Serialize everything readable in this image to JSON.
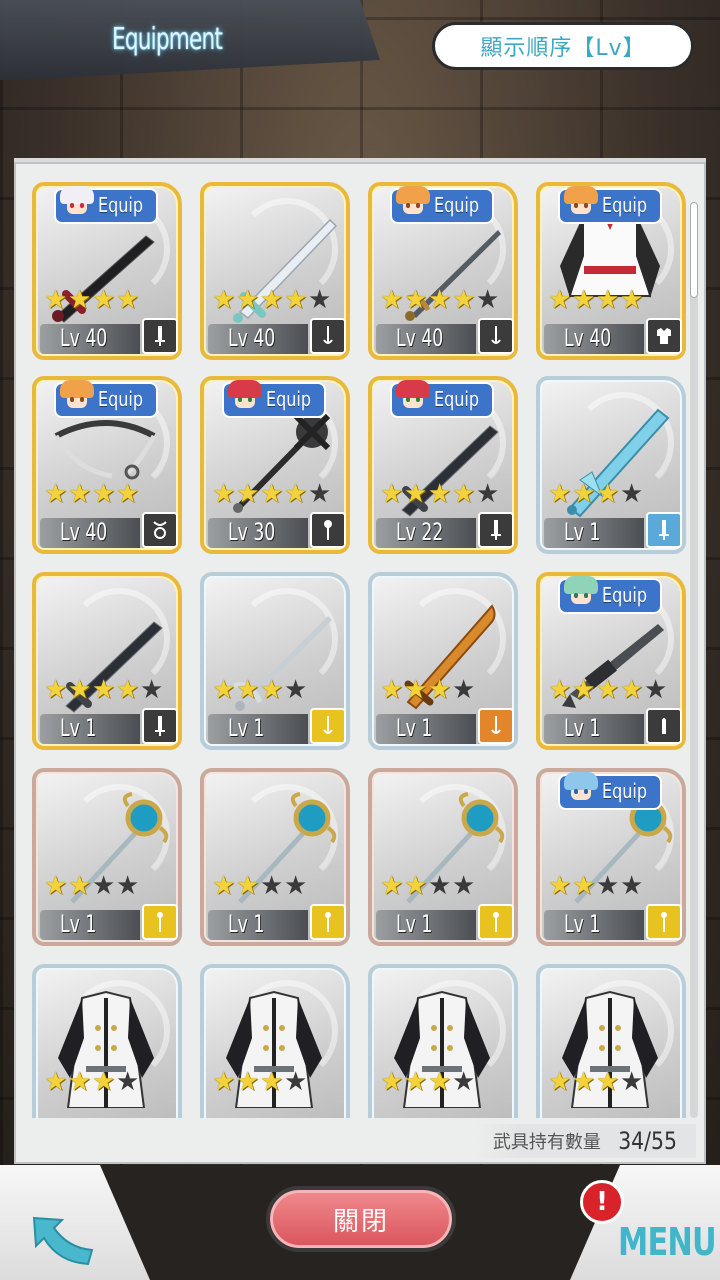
{
  "header": {
    "title": "Equipment",
    "sort_label": "顯示順序【Lv】"
  },
  "footer": {
    "count_label": "武具持有數量",
    "count_value": "34/55",
    "close_label": "關閉",
    "menu_label": "MENU",
    "alert_label": "!"
  },
  "colors": {
    "accent": "#3ca7c4",
    "close": "#d9545b",
    "gold_frame": "#e9b93b",
    "silver_frame": "#b8cdd8",
    "bronze_frame": "#c9a99c",
    "star_on": "#f4d33a"
  },
  "items": [
    {
      "frame": "gold",
      "stars": 4,
      "max_stars": 4,
      "level": "Lv 40",
      "equip": "Equip",
      "equipper": "white-hair",
      "art": "sword-black",
      "type_icon": "sword-icon",
      "type_color": "#3b3b3b"
    },
    {
      "frame": "gold",
      "stars": 4,
      "max_stars": 5,
      "level": "Lv 40",
      "equip": null,
      "art": "sword-white",
      "type_icon": "rapier-icon",
      "type_color": "#3b3b3b"
    },
    {
      "frame": "gold",
      "stars": 4,
      "max_stars": 5,
      "level": "Lv 40",
      "equip": "Equip",
      "equipper": "orange-hair",
      "art": "rapier-dark",
      "type_icon": "rapier-icon",
      "type_color": "#3b3b3b"
    },
    {
      "frame": "gold",
      "stars": 4,
      "max_stars": 4,
      "level": "Lv 40",
      "equip": "Equip",
      "equipper": "orange-hair",
      "art": "coat-red",
      "type_icon": "armor-icon",
      "type_color": "#3b3b3b"
    },
    {
      "frame": "gold",
      "stars": 4,
      "max_stars": 4,
      "level": "Lv 40",
      "equip": "Equip",
      "equipper": "orange-hair",
      "art": "circlet",
      "type_icon": "accessory-icon",
      "type_color": "#3b3b3b"
    },
    {
      "frame": "gold",
      "stars": 4,
      "max_stars": 5,
      "level": "Lv 30",
      "equip": "Equip",
      "equipper": "red-hair",
      "art": "mace",
      "type_icon": "mace-icon",
      "type_color": "#3b3b3b"
    },
    {
      "frame": "gold",
      "stars": 4,
      "max_stars": 5,
      "level": "Lv 22",
      "equip": "Equip",
      "equipper": "red-hair",
      "art": "sword-dark",
      "type_icon": "sword-icon",
      "type_color": "#3b3b3b"
    },
    {
      "frame": "silver",
      "stars": 3,
      "max_stars": 4,
      "level": "Lv 1",
      "equip": null,
      "art": "sword-crystal",
      "type_icon": "sword-icon",
      "type_color": "#5aa9d8"
    },
    {
      "frame": "gold",
      "stars": 4,
      "max_stars": 5,
      "level": "Lv 1",
      "equip": null,
      "art": "sword-dark",
      "type_icon": "sword-icon",
      "type_color": "#3b3b3b"
    },
    {
      "frame": "silver",
      "stars": 3,
      "max_stars": 4,
      "level": "Lv 1",
      "equip": null,
      "art": "rapier-light",
      "type_icon": "rapier-icon",
      "type_color": "#e8c21e"
    },
    {
      "frame": "silver",
      "stars": 3,
      "max_stars": 4,
      "level": "Lv 1",
      "equip": null,
      "art": "sword-flame",
      "type_icon": "rapier-icon",
      "type_color": "#e3852a"
    },
    {
      "frame": "gold",
      "stars": 4,
      "max_stars": 5,
      "level": "Lv 1",
      "equip": "Equip",
      "equipper": "green-hair",
      "art": "rifle",
      "type_icon": "bullet-icon",
      "type_color": "#3b3b3b"
    },
    {
      "frame": "bronze",
      "stars": 2,
      "max_stars": 4,
      "level": "Lv 1",
      "equip": null,
      "art": "staff",
      "type_icon": "staff-icon",
      "type_color": "#e8c21e"
    },
    {
      "frame": "bronze",
      "stars": 2,
      "max_stars": 4,
      "level": "Lv 1",
      "equip": null,
      "art": "staff",
      "type_icon": "staff-icon",
      "type_color": "#e8c21e"
    },
    {
      "frame": "bronze",
      "stars": 2,
      "max_stars": 4,
      "level": "Lv 1",
      "equip": null,
      "art": "staff",
      "type_icon": "staff-icon",
      "type_color": "#e8c21e"
    },
    {
      "frame": "bronze",
      "stars": 2,
      "max_stars": 4,
      "level": "Lv 1",
      "equip": "Equip",
      "equipper": "blue-hair",
      "art": "staff",
      "type_icon": "staff-icon",
      "type_color": "#e8c21e"
    },
    {
      "frame": "silver",
      "stars": 3,
      "max_stars": 4,
      "level": "",
      "equip": null,
      "art": "coat-white",
      "type_icon": "",
      "type_color": "#3b3b3b"
    },
    {
      "frame": "silver",
      "stars": 3,
      "max_stars": 4,
      "level": "",
      "equip": null,
      "art": "coat-white",
      "type_icon": "",
      "type_color": "#3b3b3b"
    },
    {
      "frame": "silver",
      "stars": 3,
      "max_stars": 4,
      "level": "",
      "equip": null,
      "art": "coat-white",
      "type_icon": "",
      "type_color": "#3b3b3b"
    },
    {
      "frame": "silver",
      "stars": 3,
      "max_stars": 4,
      "level": "",
      "equip": null,
      "art": "coat-white",
      "type_icon": "",
      "type_color": "#3b3b3b"
    }
  ]
}
